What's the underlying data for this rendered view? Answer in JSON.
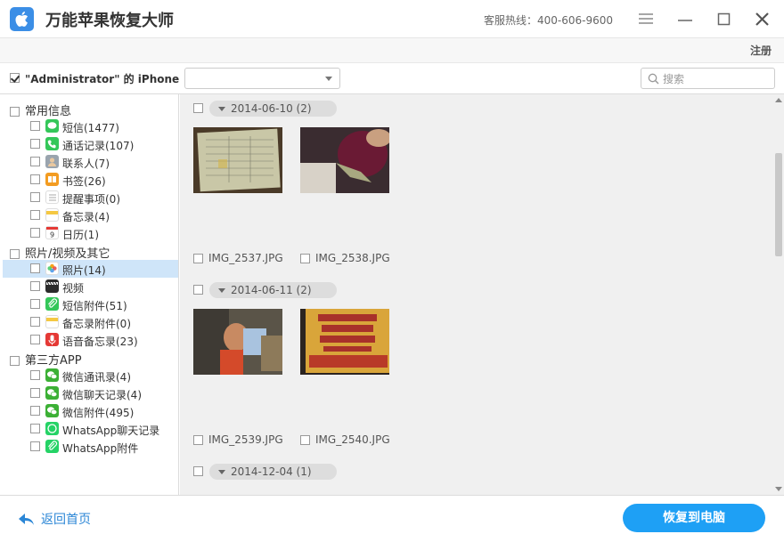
{
  "app": {
    "title": "万能苹果恢复大师",
    "hotline": "客服热线：400-606-9600"
  },
  "subbar": {
    "register": "注册"
  },
  "device": {
    "name": "\"Administrator\" 的 iPhone",
    "select_value": "",
    "search_placeholder": "搜索"
  },
  "sidebar": {
    "groups": [
      {
        "label": "常用信息",
        "items": [
          {
            "label": "短信(1477)",
            "icon": "message-icon",
            "color": "#34c759"
          },
          {
            "label": "通话记录(107)",
            "icon": "phone-icon",
            "color": "#34c759"
          },
          {
            "label": "联系人(7)",
            "icon": "contacts-icon",
            "color": "#9aa4ae"
          },
          {
            "label": "书签(26)",
            "icon": "bookmark-icon",
            "color": "#f39c21"
          },
          {
            "label": "提醒事项(0)",
            "icon": "reminders-icon",
            "color": "#ffffff"
          },
          {
            "label": "备忘录(4)",
            "icon": "notes-icon",
            "color": "#f5d76e"
          },
          {
            "label": "日历(1)",
            "icon": "calendar-icon",
            "color": "#ffffff"
          }
        ]
      },
      {
        "label": "照片/视频及其它",
        "items": [
          {
            "label": "照片(14)",
            "icon": "photos-icon",
            "color": "#f6a21a",
            "selected": true
          },
          {
            "label": "视频",
            "icon": "video-icon",
            "color": "#2b2b2b"
          },
          {
            "label": "短信附件(51)",
            "icon": "attachment-icon",
            "color": "#34c759"
          },
          {
            "label": "备忘录附件(0)",
            "icon": "notes-attachment-icon",
            "color": "#f5d76e"
          },
          {
            "label": "语音备忘录(23)",
            "icon": "voice-memo-icon",
            "color": "#e53935"
          }
        ]
      },
      {
        "label": "第三方APP",
        "items": [
          {
            "label": "微信通讯录(4)",
            "icon": "wechat-icon",
            "color": "#3cb035"
          },
          {
            "label": "微信聊天记录(4)",
            "icon": "wechat-icon",
            "color": "#3cb035"
          },
          {
            "label": "微信附件(495)",
            "icon": "wechat-icon",
            "color": "#3cb035"
          },
          {
            "label": "WhatsApp聊天记录",
            "icon": "whatsapp-icon",
            "color": "#25d366"
          },
          {
            "label": "WhatsApp附件",
            "icon": "whatsapp-icon",
            "color": "#25d366"
          }
        ]
      }
    ]
  },
  "content": {
    "dates": [
      {
        "label": "2014-06-10 (2)",
        "files": [
          "IMG_2537.JPG",
          "IMG_2538.JPG"
        ]
      },
      {
        "label": "2014-06-11 (2)",
        "files": [
          "IMG_2539.JPG",
          "IMG_2540.JPG"
        ]
      },
      {
        "label": "2014-12-04 (1)",
        "files": []
      }
    ]
  },
  "footer": {
    "back": "返回首页",
    "recover": "恢复到电脑"
  },
  "colors": {
    "accent": "#1ea0f5",
    "selected_row": "#cfe5f9",
    "link": "#2b86d6"
  }
}
